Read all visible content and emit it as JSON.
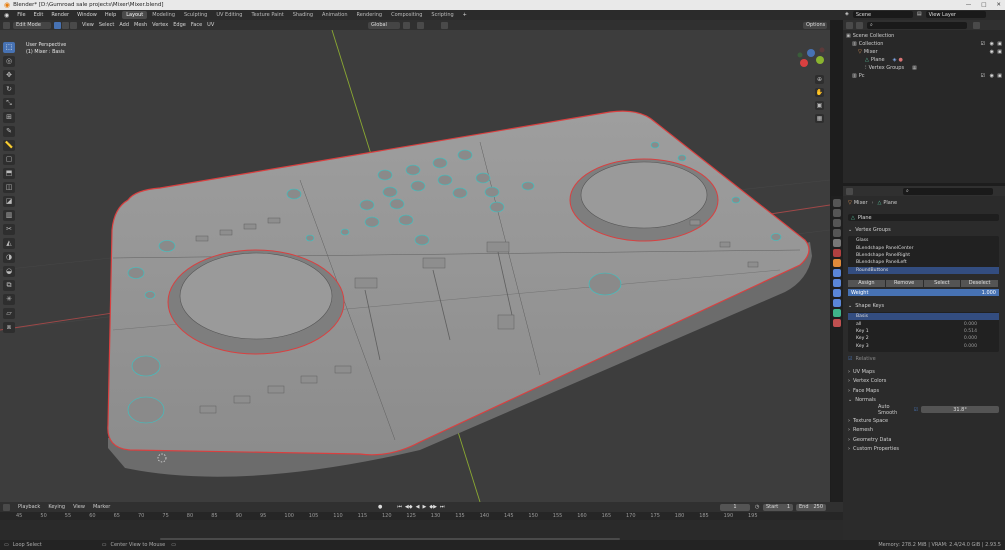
{
  "window": {
    "title": "Blender* [D:\\Gumroad sale projects\\Mixer\\Mixer.blend]",
    "controls": [
      "—",
      "□",
      "✕"
    ]
  },
  "menu": [
    "File",
    "Edit",
    "Render",
    "Window",
    "Help"
  ],
  "workspaces": [
    "Layout",
    "Modeling",
    "Sculpting",
    "UV Editing",
    "Texture Paint",
    "Shading",
    "Animation",
    "Rendering",
    "Compositing",
    "Scripting"
  ],
  "active_workspace": "Layout",
  "scene": {
    "label": "Scene",
    "view_layer": "View Layer"
  },
  "viewport_header": {
    "mode": "Edit Mode",
    "menus": [
      "View",
      "Select",
      "Add",
      "Mesh",
      "Vertex",
      "Edge",
      "Face",
      "UV"
    ],
    "orientation": "Global",
    "options": "Options"
  },
  "viewport": {
    "perspective": "User Perspective",
    "object_info": "(1) Mixer : Basis"
  },
  "outliner": {
    "rows": [
      {
        "label": "Scene Collection",
        "indent": 0
      },
      {
        "label": "Collection",
        "indent": 1
      },
      {
        "label": "Mixer",
        "indent": 2
      },
      {
        "label": "Plane",
        "indent": 3
      },
      {
        "label": "Vertex Groups",
        "indent": 3
      },
      {
        "label": "Pc",
        "indent": 1
      }
    ]
  },
  "properties": {
    "breadcrumb": {
      "object": "Mixer",
      "mesh": "Plane"
    },
    "data_name": "Plane",
    "vertex_groups": {
      "title": "Vertex Groups",
      "items": [
        "Glass",
        "BLendshape PanelCenter",
        "BLendshape PanelRight",
        "BLendshape PanelLeft",
        "RoundButtons"
      ],
      "selected": 4,
      "buttons": [
        "Assign",
        "Remove",
        "Select",
        "Deselect"
      ],
      "weight_label": "Weight",
      "weight_value": "1.000"
    },
    "shape_keys": {
      "title": "Shape Keys",
      "items": [
        {
          "name": "Basis",
          "value": ""
        },
        {
          "name": "all",
          "value": "0.000"
        },
        {
          "name": "Key 1",
          "value": "0.514"
        },
        {
          "name": "Key 2",
          "value": "0.000"
        },
        {
          "name": "Key 3",
          "value": "0.000"
        }
      ],
      "selected": 0,
      "relative_label": "Relative"
    },
    "collapsed_sections": [
      "UV Maps",
      "Vertex Colors",
      "Face Maps"
    ],
    "normals": {
      "title": "Normals",
      "auto_smooth_label": "Auto Smooth",
      "angle": "31.8°"
    },
    "more_sections": [
      "Texture Space",
      "Remesh",
      "Geometry Data",
      "Custom Properties"
    ]
  },
  "timeline": {
    "menus": [
      "Playback",
      "Keying",
      "View",
      "Marker"
    ],
    "current_frame": "1",
    "start_label": "Start",
    "start": "1",
    "end_label": "End",
    "end": "250",
    "ticks": [
      "45",
      "50",
      "55",
      "60",
      "65",
      "70",
      "75",
      "80",
      "85",
      "90",
      "95",
      "100",
      "105",
      "110",
      "115",
      "120",
      "125",
      "130",
      "135",
      "140",
      "145",
      "150",
      "155",
      "160",
      "165",
      "170",
      "175",
      "180",
      "185",
      "190",
      "195"
    ]
  },
  "status": {
    "left": "Loop Select",
    "middle": "Center View to Mouse",
    "right": "Memory: 278.2 MiB | VRAM: 2.4/24.0 GiB | 2.93.5"
  },
  "colors": {
    "accent": "#4772b3",
    "selected_row": "#334d80",
    "mesh_edge": "#d94040",
    "selection": "#33c8c8"
  }
}
